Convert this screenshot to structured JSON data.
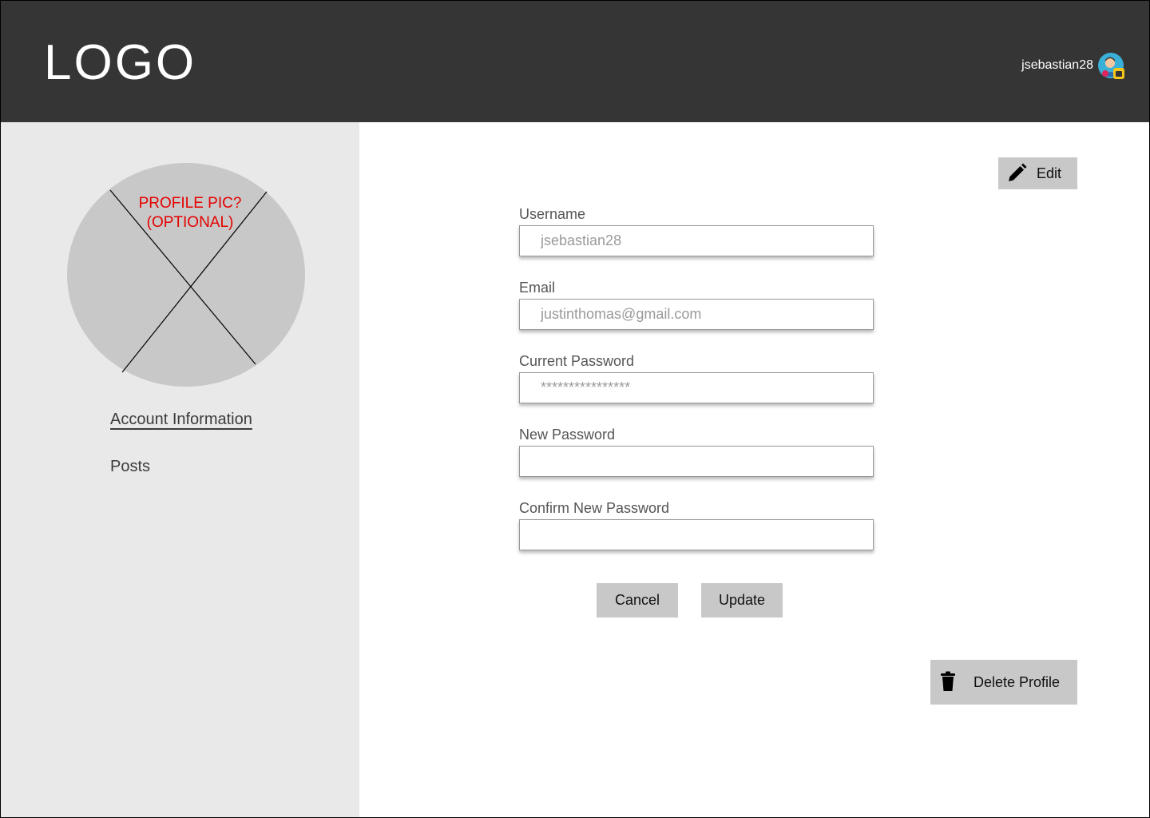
{
  "header": {
    "logo": "LOGO",
    "username": "jsebastian28",
    "avatar_icon": "user-avatar-icon"
  },
  "sidebar": {
    "profile_pic_label": "PROFILE PIC? (OPTIONAL)",
    "nav": [
      {
        "label": "Account Information",
        "active": true
      },
      {
        "label": "Posts",
        "active": false
      }
    ]
  },
  "main": {
    "edit_label": "Edit",
    "fields": {
      "username": {
        "label": "Username",
        "placeholder": "jsebastian28"
      },
      "email": {
        "label": "Email",
        "placeholder": "justinthomas@gmail.com"
      },
      "current_password": {
        "label": "Current Password",
        "placeholder": "****************"
      },
      "new_password": {
        "label": "New Password",
        "placeholder": ""
      },
      "confirm_password": {
        "label": "Confirm New Password",
        "placeholder": ""
      }
    },
    "cancel_label": "Cancel",
    "update_label": "Update",
    "delete_label": "Delete Profile"
  },
  "colors": {
    "header_bg": "#353535",
    "sidebar_bg": "#e9e9e9",
    "button_bg": "#c8c8c8",
    "placeholder_label": "#e60000"
  }
}
